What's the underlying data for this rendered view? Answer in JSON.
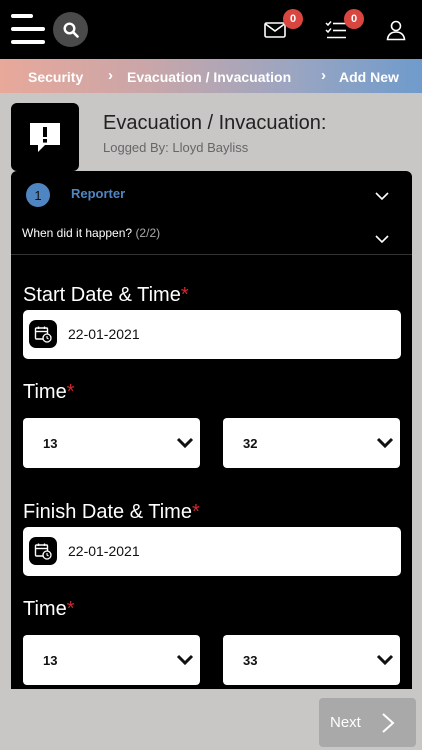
{
  "topbar": {
    "mail_count": "0",
    "tasks_count": "0"
  },
  "breadcrumb": {
    "items": [
      "Security",
      "Evacuation / Invacuation",
      "Add New"
    ],
    "separator": "›"
  },
  "header": {
    "title": "Evacuation / Invacuation:",
    "subtitle": "Logged By: Lloyd Bayliss"
  },
  "section": {
    "step_number": "1",
    "step_label": "Reporter",
    "question": "When did it happen?",
    "question_progress": "(2/2)"
  },
  "form": {
    "start_label": "Start Date & Time",
    "start_date": "22-01-2021",
    "start_time_label": "Time",
    "start_hour": "13",
    "start_minute": "32",
    "finish_label": "Finish Date & Time",
    "finish_date": "22-01-2021",
    "finish_time_label": "Time",
    "finish_hour": "13",
    "finish_minute": "33",
    "required_mark": "*"
  },
  "footer": {
    "next_label": "Next"
  },
  "colors": {
    "accent": "#4f86c2",
    "badge": "#d9463f",
    "required": "#d8252a"
  },
  "icons": [
    "menu-icon",
    "search-icon",
    "mail-icon",
    "tasks-icon",
    "user-icon",
    "alert-icon",
    "chevron-down-icon",
    "calendar-clock-icon",
    "chevron-right-icon"
  ]
}
